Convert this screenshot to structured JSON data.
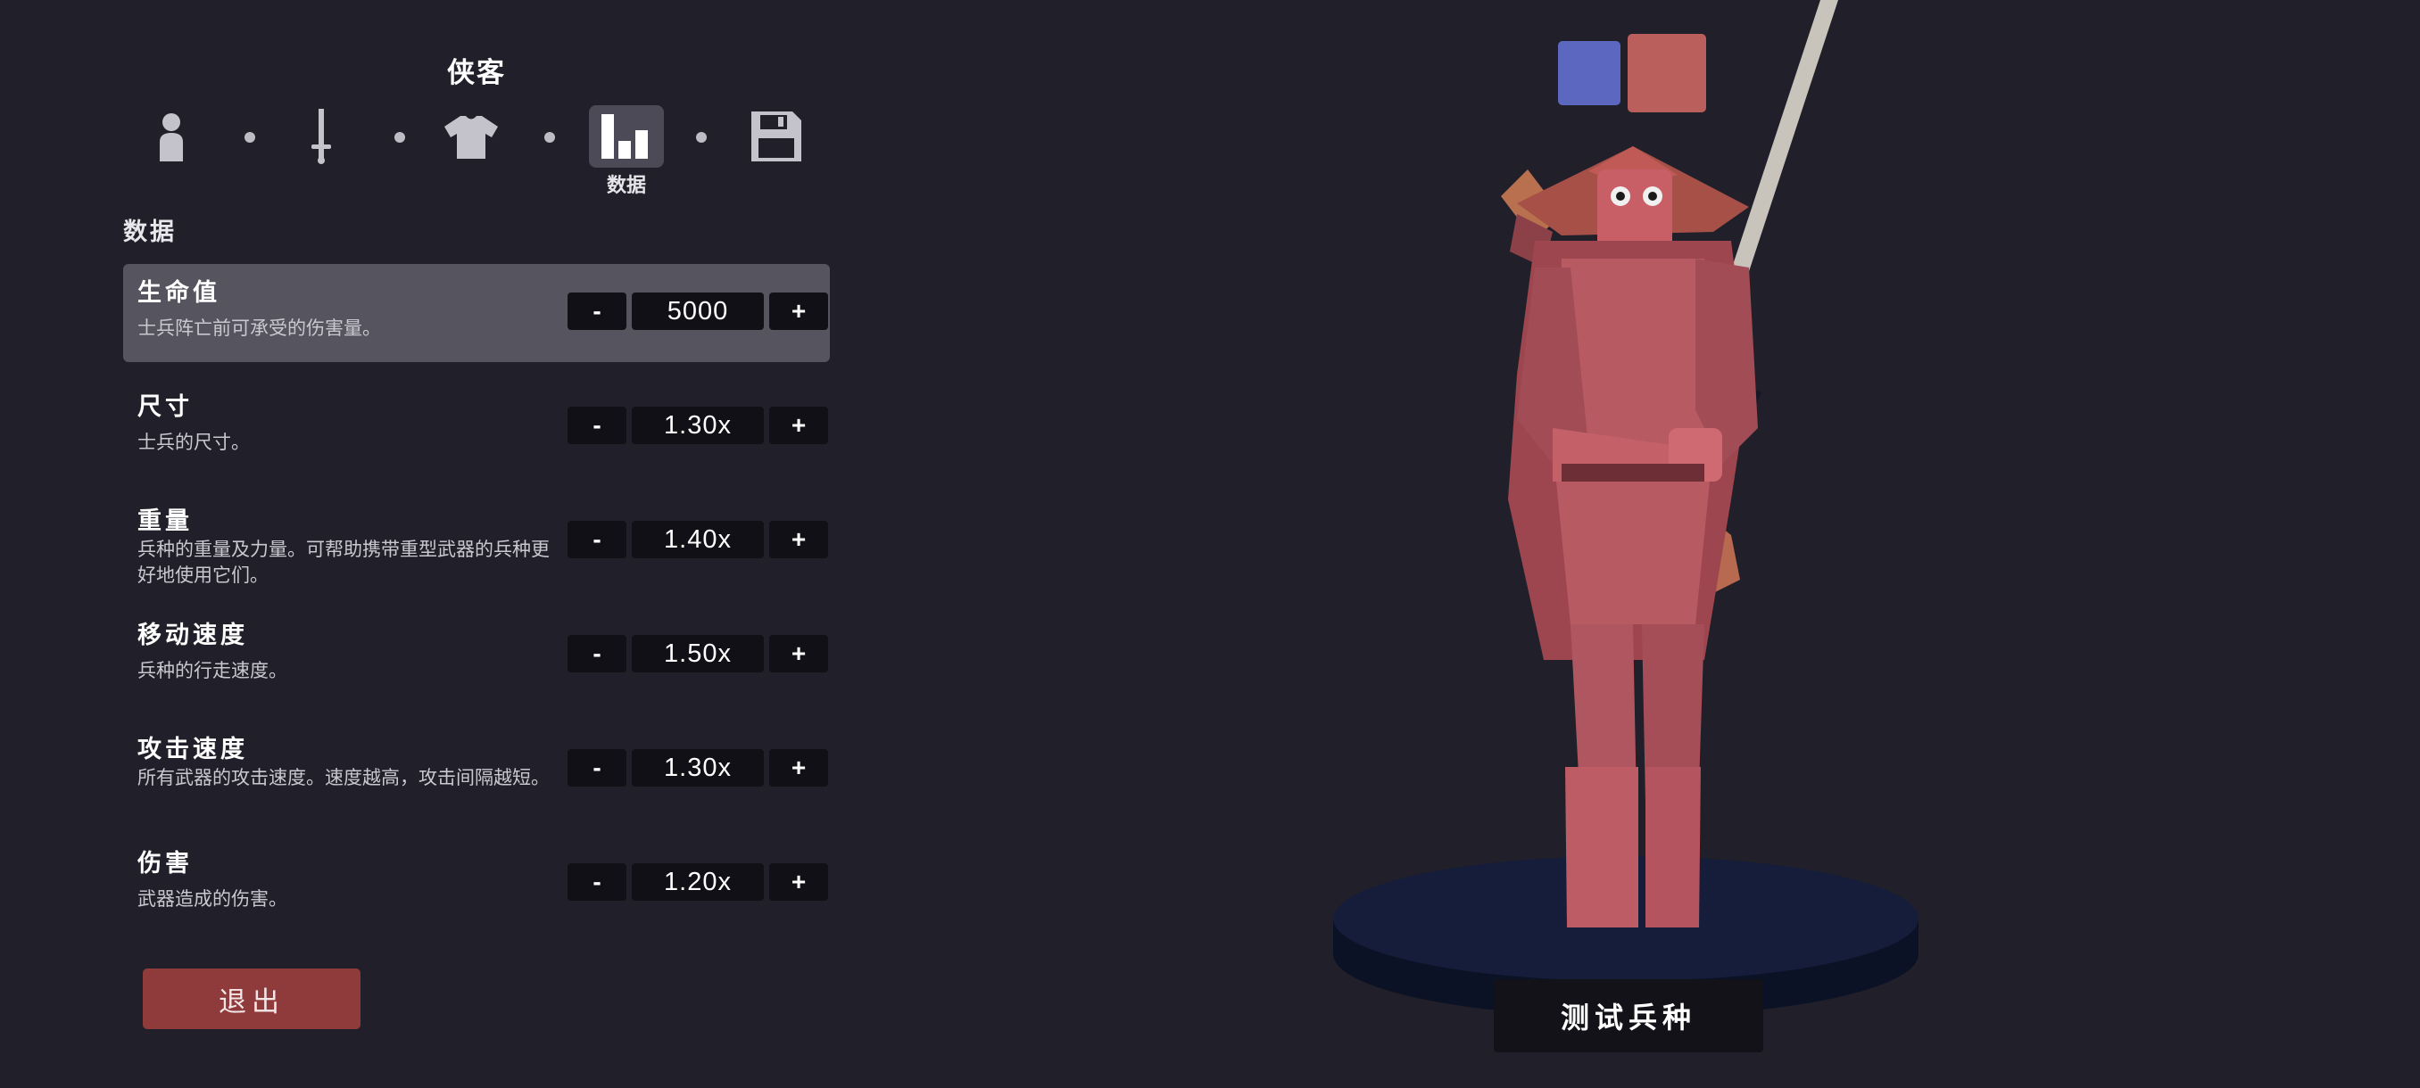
{
  "header": {
    "unit_name": "侠客"
  },
  "steps": [
    {
      "icon": "person-icon",
      "active": false
    },
    {
      "icon": "sword-icon",
      "active": false
    },
    {
      "icon": "shirt-icon",
      "active": false
    },
    {
      "icon": "stats-bar-icon",
      "active": true,
      "label": "数据"
    },
    {
      "icon": "save-disk-icon",
      "active": false
    }
  ],
  "section_title": "数据",
  "stats": [
    {
      "name": "生命值",
      "desc": "士兵阵亡前可承受的伤害量。",
      "value": "5000",
      "highlight": true
    },
    {
      "name": "尺寸",
      "desc": "士兵的尺寸。",
      "value": "1.30x"
    },
    {
      "name": "重量",
      "desc": "兵种的重量及力量。可帮助携带重型武器的兵种更好地使用它们。",
      "value": "1.40x"
    },
    {
      "name": "移动速度",
      "desc": "兵种的行走速度。",
      "value": "1.50x"
    },
    {
      "name": "攻击速度",
      "desc": "所有武器的攻击速度。速度越高，攻击间隔越短。",
      "value": "1.30x"
    },
    {
      "name": "伤害",
      "desc": "武器造成的伤害。",
      "value": "1.20x"
    }
  ],
  "controls": {
    "minus_label": "-",
    "plus_label": "+"
  },
  "exit_label": "退出",
  "test_label": "测试兵种",
  "colors": {
    "swatch_primary": "#5c67bf",
    "swatch_secondary": "#bb5f5c",
    "accent_exit": "#8f3a3b",
    "unit_body": "#b85a62",
    "pedestal": "#121a33"
  }
}
